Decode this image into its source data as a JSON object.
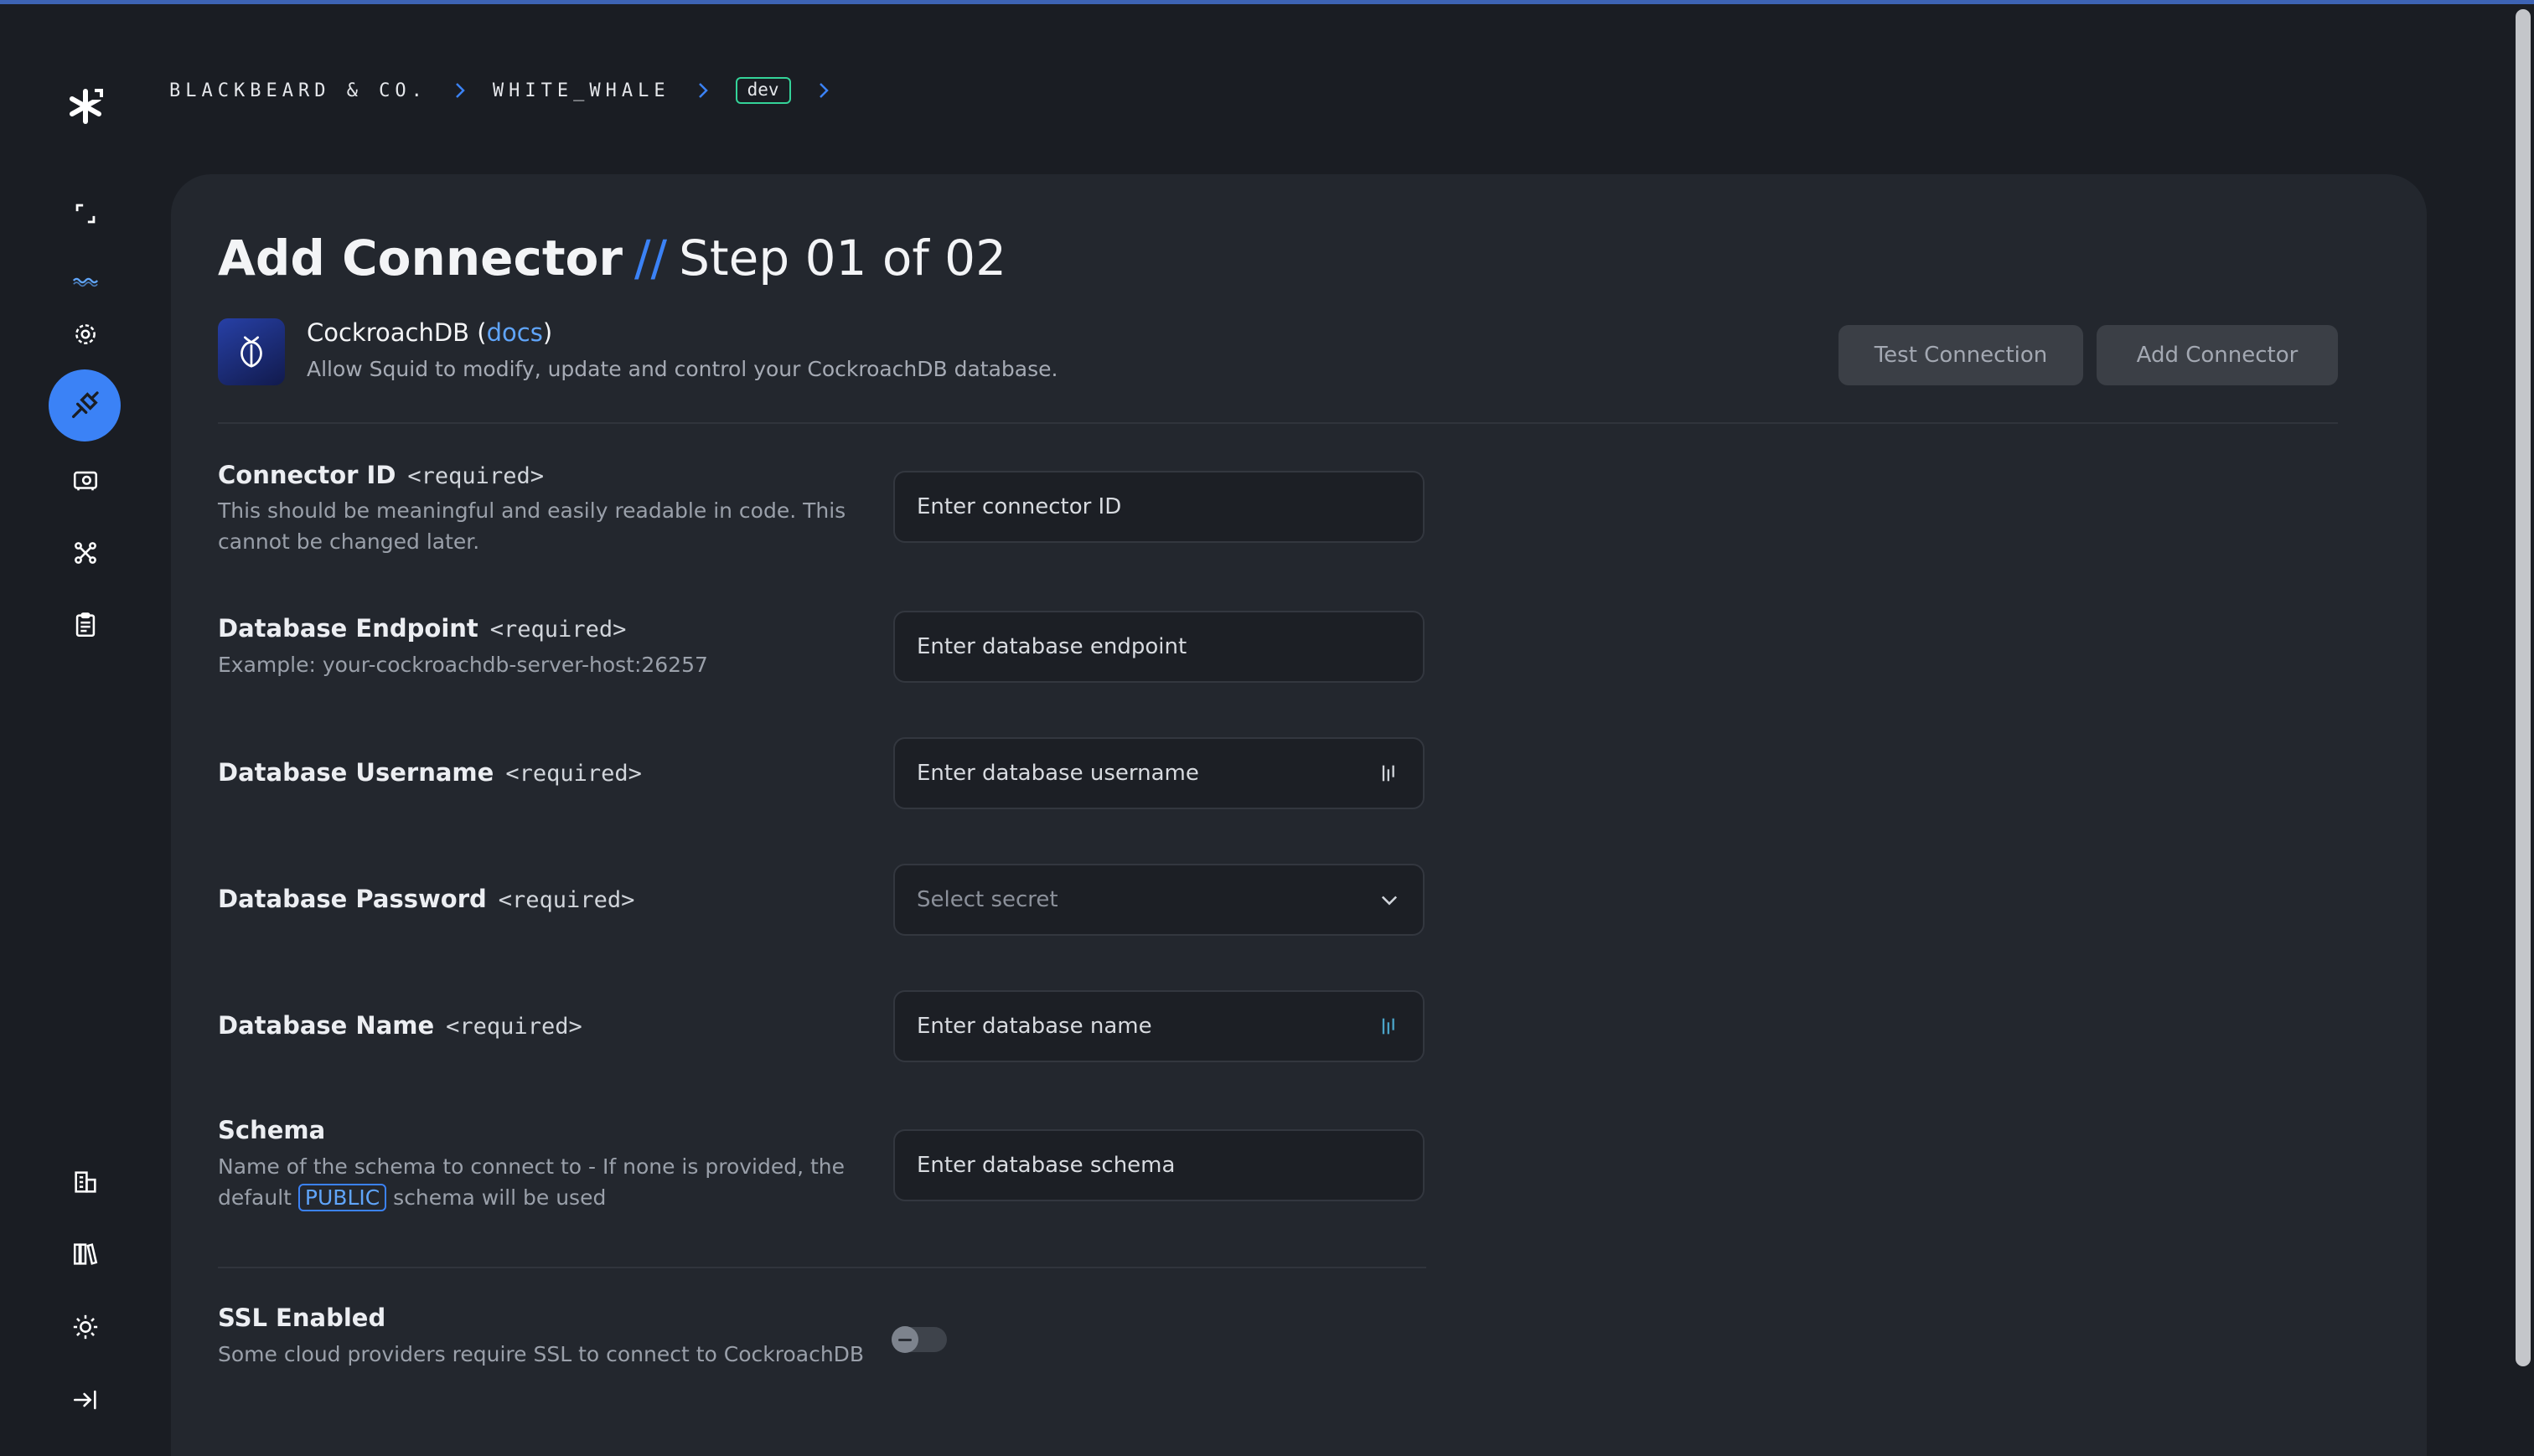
{
  "breadcrumb": {
    "org": "BLACKBEARD & CO.",
    "project": "WHITE_WHALE",
    "environment": "dev"
  },
  "sidebar": {
    "icons": [
      "collapse-icon",
      "wave-icon",
      "settings-cog-icon",
      "connector-plug-icon",
      "vault-icon",
      "integrations-graph-icon",
      "clipboard-icon",
      "organization-icon",
      "library-icon",
      "settings-sun-icon",
      "logout-icon"
    ],
    "active": "connector-plug-icon"
  },
  "page": {
    "title": "Add Connector",
    "separator": "//",
    "step": "Step 01 of 02"
  },
  "connector": {
    "name": "CockroachDB",
    "paren_open": " (",
    "docs_link": "docs",
    "paren_close": ")",
    "description": "Allow Squid to modify, update and control your CockroachDB database."
  },
  "actions": {
    "test_label": "Test Connection",
    "add_label": "Add Connector"
  },
  "form": {
    "required_tag": "<required>",
    "connector_id": {
      "label": "Connector ID",
      "help": "This should be meaningful and easily readable in code. This cannot be changed later.",
      "placeholder": "Enter connector ID"
    },
    "endpoint": {
      "label": "Database Endpoint",
      "help": "Example: your-cockroachdb-server-host:26257",
      "placeholder": "Enter database endpoint"
    },
    "username": {
      "label": "Database Username",
      "placeholder": "Enter database username"
    },
    "password": {
      "label": "Database Password",
      "placeholder": "Select secret"
    },
    "dbname": {
      "label": "Database Name",
      "placeholder": "Enter database name"
    },
    "schema": {
      "label": "Schema",
      "help_before": "Name of the schema to connect to - If none is provided, the default ",
      "help_pill": "PUBLIC",
      "help_after": " schema will be used",
      "placeholder": "Enter database schema"
    },
    "ssl": {
      "label": "SSL Enabled",
      "help": "Some cloud providers require SSL to connect to CockroachDB",
      "enabled": false
    }
  },
  "colors": {
    "accent": "#3b82f6",
    "env_badge_border": "#34d399",
    "panel": "#23272e",
    "background": "#1a1d23"
  }
}
